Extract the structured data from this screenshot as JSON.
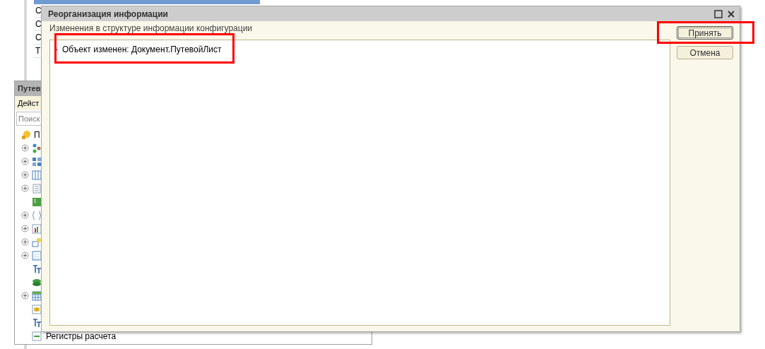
{
  "background_table": {
    "rows": [
      {
        "cell": "С"
      },
      {
        "cell": "С"
      },
      {
        "cell": "С"
      },
      {
        "cell": "Т"
      }
    ]
  },
  "side_window": {
    "title": "Путев",
    "menu": "Дейст",
    "search": {
      "placeholder": "Поиск"
    },
    "tree": [
      {
        "kind": "ball",
        "text": "П"
      },
      {
        "kind": "nodes",
        "expandable": true
      },
      {
        "kind": "blocks",
        "expandable": true
      },
      {
        "kind": "columns",
        "expandable": true
      },
      {
        "kind": "doc",
        "expandable": true
      },
      {
        "kind": "green",
        "expandable": false
      },
      {
        "kind": "braces",
        "expandable": true
      },
      {
        "kind": "chart",
        "expandable": true
      },
      {
        "kind": "import",
        "expandable": true
      },
      {
        "kind": "calendar",
        "expandable": true
      },
      {
        "kind": "text",
        "expandable": false
      },
      {
        "kind": "leaf",
        "expandable": false
      },
      {
        "kind": "grid",
        "expandable": true
      },
      {
        "kind": "coins",
        "expandable": false
      },
      {
        "kind": "text",
        "expandable": false
      },
      {
        "kind": "register",
        "expandable": false,
        "text": "Регистры расчета"
      }
    ]
  },
  "dialog": {
    "title": "Реорганизация информации",
    "header": "Изменения в структуре информации конфигурации",
    "items": [
      {
        "text": "Объект изменен: Документ.ПутевойЛист"
      }
    ],
    "buttons": [
      {
        "label": "Принять",
        "default": true
      },
      {
        "label": "Отмена",
        "default": false
      }
    ]
  }
}
